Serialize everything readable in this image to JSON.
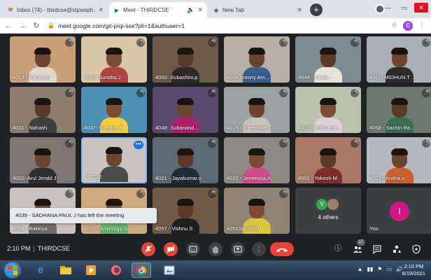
{
  "browser": {
    "tabs": [
      {
        "title": "Inbox (74) - thirdcse@stjoseph.a",
        "icon": "M",
        "icon_color": "#d93025",
        "active": false
      },
      {
        "title": "Meet - THIRDCSE",
        "icon": "▶",
        "icon_color": "#00832d",
        "active": true,
        "extra_icon": "🔈"
      },
      {
        "title": "New Tab",
        "icon": "◉",
        "icon_color": "#5f6368",
        "active": false
      }
    ],
    "new_tab_label": "+",
    "url": "meet.google.com/git-prqi-sse?pli=1&authuser=1",
    "profile_initial": "C"
  },
  "participants": [
    {
      "name": "4013 - Ramaran",
      "bg": "#c9a07a",
      "shirt": "#e0d8cc",
      "skin": "#6b4530",
      "muted": true
    },
    {
      "name": "4052- Sunitha.J",
      "bg": "#d8c8a8",
      "shirt": "#b2433f",
      "skin": "#7a4c35",
      "muted": true
    },
    {
      "name": "4050- Subashini.p",
      "bg": "#6e5a4a",
      "shirt": "#2f2a28",
      "skin": "#5a3a28",
      "muted": true
    },
    {
      "name": "4004 Antony Am...",
      "bg": "#b7b0a7",
      "shirt": "#3a5d8f",
      "skin": "#6a432c",
      "muted": true
    },
    {
      "name": "4044 - Karthi...",
      "bg": "#7e8b93",
      "shirt": "#e6e2dc",
      "skin": "#5c3a26",
      "muted": true
    },
    {
      "name": "4501- MIDHUN.T ...",
      "bg": "#a9b0b3",
      "shirt": "#2b2b2b",
      "skin": "#6b4530",
      "muted": true
    },
    {
      "name": "4031 - Nahash",
      "bg": "#8c7d6e",
      "shirt": "#3f3f3f",
      "skin": "#5a3a28",
      "muted": true
    },
    {
      "name": "4047- Snegha. B",
      "bg": "#4d8fb5",
      "shirt": "#f2cc3d",
      "skin": "#7a4c35",
      "muted": true
    },
    {
      "name": "4048- Subanand...",
      "bg": "#5a4a6e",
      "shirt": "#b01e6b",
      "skin": "#6b4530",
      "muted": true
    },
    {
      "name": "4019 - S Hemalat...",
      "bg": "#9aa2a4",
      "shirt": "#c8c0b8",
      "skin": "#6b4530",
      "muted": true
    },
    {
      "name": "4020- Vishnu pri...",
      "bg": "#b8c2ad",
      "shirt": "#e0cfd7",
      "skin": "#7a4c35",
      "muted": true
    },
    {
      "name": "4058 - Sachin Ra...",
      "bg": "#6b7a6d",
      "shirt": "#3b6d50",
      "skin": "#5a3a28",
      "muted": true
    },
    {
      "name": "4002- Arul Jerald J",
      "bg": "#7d7672",
      "shirt": "#2e2e2e",
      "skin": "#6b4530",
      "muted": true
    },
    {
      "name": "III CSE",
      "bg": "#c9c4bf",
      "shirt": "#4a4a4a",
      "skin": "#6b4530",
      "muted": false,
      "pinned": true
    },
    {
      "name": "4021 - Jayakumar.v",
      "bg": "#5d6a74",
      "shirt": "#1f2a38",
      "skin": "#5a3a28",
      "muted": true
    },
    {
      "name": "4022 - Jeneesha.A",
      "bg": "#8d8a86",
      "shirt": "#d24b8b",
      "skin": "#7a4c35",
      "muted": true
    },
    {
      "name": "4061 - Yokesh M",
      "bg": "#a87a65",
      "shirt": "#7a2e2e",
      "skin": "#5a3a28",
      "muted": true
    },
    {
      "name": "4003 - Anitha.v",
      "bg": "#b5b9bd",
      "shirt": "#c9602f",
      "skin": "#6b4530",
      "muted": true
    },
    {
      "name": "4008 - Bakkiya",
      "bg": "#c8c2bd",
      "shirt": "#6e6b66",
      "skin": "#7a4c35",
      "muted": true
    },
    {
      "name": "4025 - Amirthiga.S",
      "bg": "#cfa980",
      "shirt": "#66b565",
      "skin": "#7a4c35",
      "muted": true
    },
    {
      "name": "4057 - Vishnu S",
      "bg": "#6f5a48",
      "shirt": "#1f1f1f",
      "skin": "#5a3a28",
      "muted": true
    },
    {
      "name": "4051Sumithra",
      "bg": "#8f8473",
      "shirt": "#d8c640",
      "skin": "#7a4c35",
      "muted": true
    }
  ],
  "others_tile": {
    "label": "4 others",
    "avatars": [
      "V",
      ""
    ]
  },
  "you_tile": {
    "label": "You",
    "initial": "I"
  },
  "toast": "4039 - SADHANA PAUL J has left the meeting",
  "controls": {
    "time": "2:10 PM",
    "meeting_code": "THIRDCSE",
    "participant_count": "27"
  },
  "taskbar": {
    "clock_time": "2:10 PM",
    "clock_date": "8/19/2021"
  }
}
